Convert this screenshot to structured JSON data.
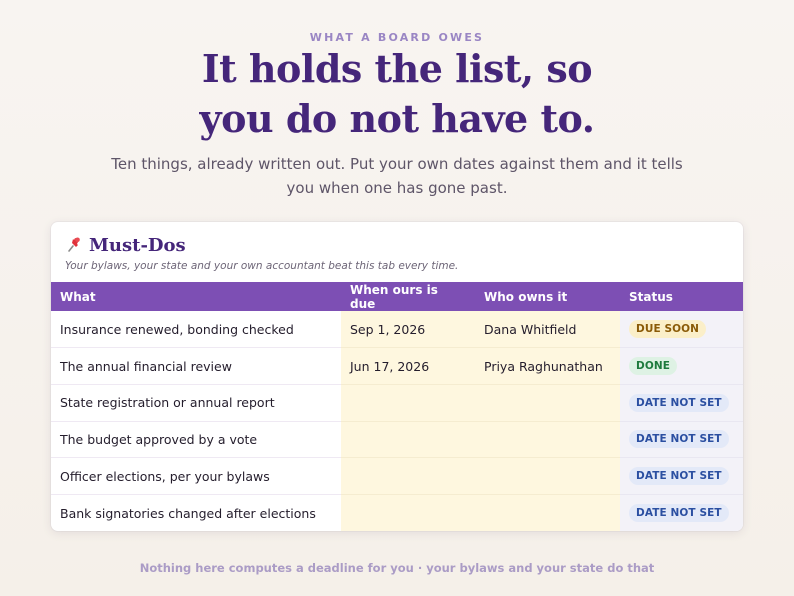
{
  "hero": {
    "eyebrow": "WHAT A BOARD OWES",
    "headline_line1": "It holds the list, so",
    "headline_line2": "you do not have to.",
    "subtitle": "Ten things, already written out. Put your own dates against them and it tells you when one has gone past."
  },
  "card": {
    "icon": "pushpin-icon",
    "title": "Must-Dos",
    "note": "Your bylaws, your state and your own accountant beat this tab every time.",
    "columns": [
      "What",
      "When ours is due",
      "Who owns it",
      "Status"
    ],
    "rows": [
      {
        "what": "Insurance renewed, bonding checked",
        "due": "Sep 1, 2026",
        "owner": "Dana Whitfield",
        "status": "DUE SOON",
        "kind": "soon"
      },
      {
        "what": "The annual financial review",
        "due": "Jun 17, 2026",
        "owner": "Priya Raghunathan",
        "status": "DONE",
        "kind": "done"
      },
      {
        "what": "State registration or annual report",
        "due": "",
        "owner": "",
        "status": "DATE NOT SET",
        "kind": "notset"
      },
      {
        "what": "The budget approved by a vote",
        "due": "",
        "owner": "",
        "status": "DATE NOT SET",
        "kind": "notset"
      },
      {
        "what": "Officer elections, per your bylaws",
        "due": "",
        "owner": "",
        "status": "DATE NOT SET",
        "kind": "notset"
      },
      {
        "what": "Bank signatories changed after elections",
        "due": "",
        "owner": "",
        "status": "DATE NOT SET",
        "kind": "notset"
      }
    ]
  },
  "footer": "Nothing here computes a deadline for you · your bylaws and your state do that",
  "colors": {
    "accent": "#7d4fb4",
    "headline": "#45267a",
    "due_soon": "#8a5a07",
    "done": "#1e7a3d",
    "not_set": "#2b4fa1"
  }
}
